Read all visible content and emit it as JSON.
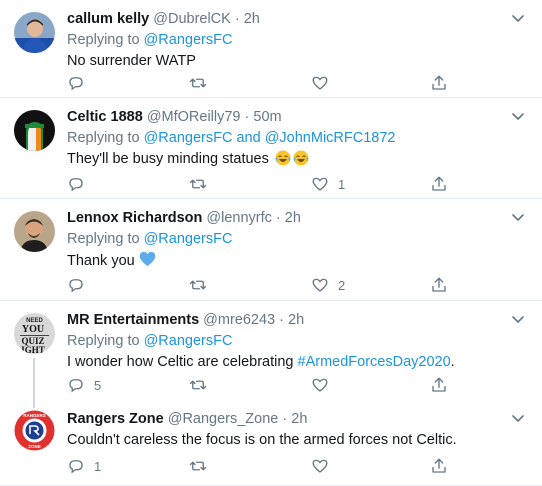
{
  "tweets": [
    {
      "name": "callum kelly",
      "handle": "@DubrelCK",
      "dot": "·",
      "time": "2h",
      "replying_prefix": "Replying to",
      "replying_to": [
        "@RangersFC"
      ],
      "replying_joiner": "",
      "text": "No surrender WATP",
      "replies": "",
      "retweets": "",
      "likes": "",
      "avatar_icon": "person-avatar"
    },
    {
      "name": "Celtic 1888",
      "handle": "@MfOReilly79",
      "dot": "·",
      "time": "50m",
      "replying_prefix": "Replying to",
      "replying_to": [
        "@RangersFC",
        "@JohnMicRFC1872"
      ],
      "replying_joiner": "and",
      "text": "They'll be busy minding statues",
      "text_emoji": [
        "face-with-tears-of-joy",
        "face-with-tears-of-joy"
      ],
      "replies": "",
      "retweets": "",
      "likes": "1",
      "avatar_icon": "raised-fist-avatar"
    },
    {
      "name": "Lennox Richardson",
      "handle": "@lennyrfc",
      "dot": "·",
      "time": "2h",
      "replying_prefix": "Replying to",
      "replying_to": [
        "@RangersFC"
      ],
      "replying_joiner": "",
      "text": "Thank you",
      "text_emoji": [
        "blue-heart"
      ],
      "replies": "",
      "retweets": "",
      "likes": "2",
      "avatar_icon": "person-avatar"
    },
    {
      "name": "MR Entertainments",
      "handle": "@mre6243",
      "dot": "·",
      "time": "2h",
      "replying_prefix": "Replying to",
      "replying_to": [
        "@RangersFC"
      ],
      "replying_joiner": "",
      "text": "I wonder how Celtic are celebrating",
      "hashtag": "#ArmedForcesDay2020",
      "text_suffix": ".",
      "replies": "5",
      "retweets": "",
      "likes": "",
      "avatar_text": [
        "NEED",
        "YOU",
        "QUIZ",
        "IGHT"
      ],
      "avatar_icon": "quiz-poster-avatar"
    },
    {
      "name": "Rangers Zone",
      "handle": "@Rangers_Zone",
      "dot": "·",
      "time": "2h",
      "replying_prefix": "",
      "replying_to": [],
      "replying_joiner": "",
      "text": "Couldn't careless the focus is on the armed forces not Celtic.",
      "replies": "1",
      "retweets": "",
      "likes": "",
      "avatar_text": [
        "RANGERS",
        "ZONE"
      ],
      "avatar_icon": "rangers-crest-avatar"
    }
  ],
  "colors": {
    "link": "#1b95e0",
    "muted": "#657786",
    "border": "#e6ecf0"
  }
}
